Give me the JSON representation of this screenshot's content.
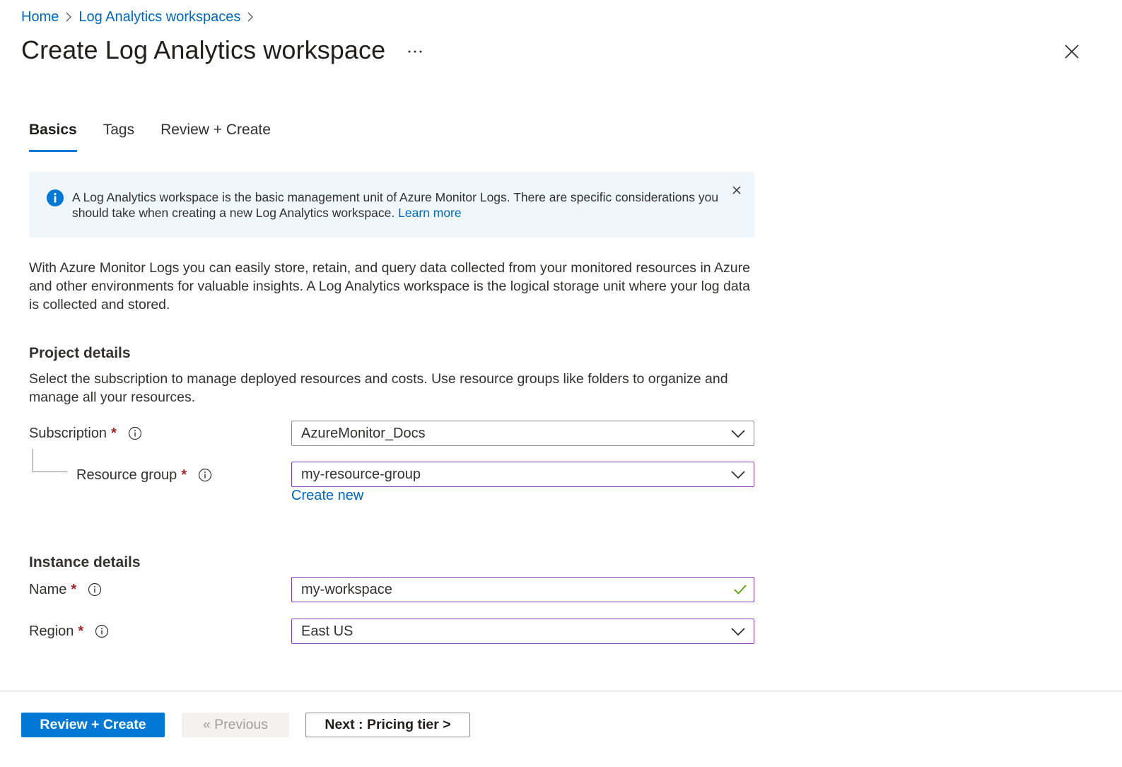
{
  "breadcrumb": {
    "items": [
      "Home",
      "Log Analytics workspaces"
    ]
  },
  "page": {
    "title": "Create Log Analytics workspace",
    "more_label": "···"
  },
  "tabs": [
    {
      "label": "Basics",
      "active": true
    },
    {
      "label": "Tags",
      "active": false
    },
    {
      "label": "Review + Create",
      "active": false
    }
  ],
  "banner": {
    "text": "A Log Analytics workspace is the basic management unit of Azure Monitor Logs. There are specific considerations you should take when creating a new Log Analytics workspace.",
    "link": "Learn more"
  },
  "intro": "With Azure Monitor Logs you can easily store, retain, and query data collected from your monitored resources in Azure and other environments for valuable insights. A Log Analytics workspace is the logical storage unit where your log data is collected and stored.",
  "project": {
    "heading": "Project details",
    "description": "Select the subscription to manage deployed resources and costs. Use resource groups like folders to organize and manage all your resources.",
    "subscription_label": "Subscription",
    "subscription_value": "AzureMonitor_Docs",
    "resource_group_label": "Resource group",
    "resource_group_value": "my-resource-group",
    "create_new": "Create new"
  },
  "instance": {
    "heading": "Instance details",
    "name_label": "Name",
    "name_value": "my-workspace",
    "region_label": "Region",
    "region_value": "East US"
  },
  "required_marker": "*",
  "footer": {
    "review_create": "Review + Create",
    "previous": "« Previous",
    "next": "Next : Pricing tier >"
  },
  "colors": {
    "accent": "#0078d4",
    "link": "#0067b8",
    "required": "#a4262c",
    "focus_border": "#8a3cb4",
    "success": "#57a300",
    "banner_bg": "#eff6fc"
  },
  "icons": {
    "chevron_right": "chevron-right-icon",
    "more": "more-icon",
    "close": "close-icon",
    "info": "info-icon",
    "chevron_down": "chevron-down-icon",
    "check": "checkmark-icon"
  }
}
